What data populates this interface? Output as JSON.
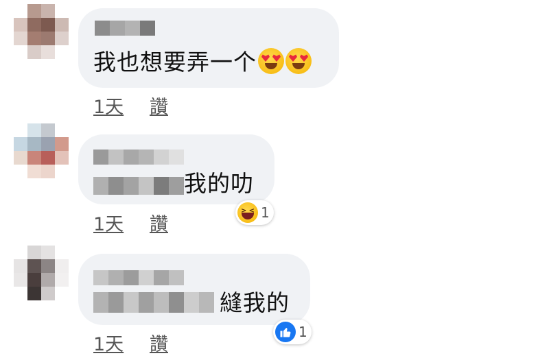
{
  "comments": [
    {
      "text": "我也想要弄一个",
      "time_label": "1天",
      "like_label": "讚",
      "text_emojis": [
        "heart-eyes-emoji",
        "heart-eyes-emoji"
      ]
    },
    {
      "text": "我的叻",
      "time_label": "1天",
      "like_label": "讚",
      "reaction": {
        "icon": "laughing-reaction-icon",
        "count": "1"
      }
    },
    {
      "text": "縫我的",
      "time_label": "1天",
      "like_label": "讚",
      "reaction": {
        "icon": "like-reaction-icon",
        "count": "1"
      }
    }
  ],
  "colors": {
    "bubble": "#f0f2f5",
    "link": "#555555",
    "like_blue": "#1877f2"
  }
}
